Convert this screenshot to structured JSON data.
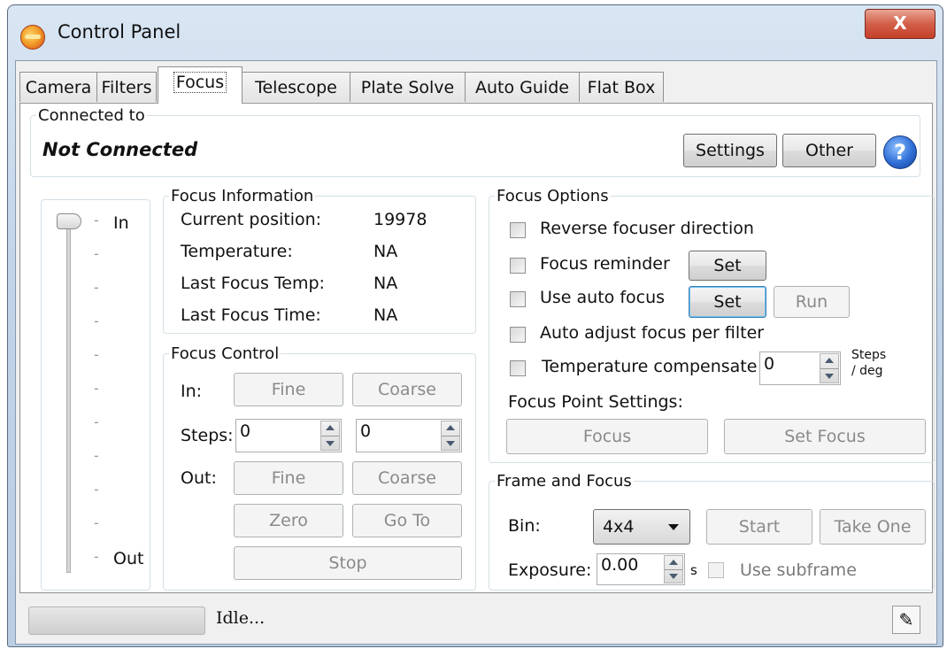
{
  "window": {
    "title": "Control Panel",
    "close_glyph": "X"
  },
  "tabs": [
    {
      "label": "Camera"
    },
    {
      "label": "Filters"
    },
    {
      "label": "Focus"
    },
    {
      "label": "Telescope"
    },
    {
      "label": "Plate Solve"
    },
    {
      "label": "Auto Guide"
    },
    {
      "label": "Flat Box"
    }
  ],
  "connection": {
    "legend": "Connected to",
    "status": "Not Connected",
    "settings_label": "Settings",
    "other_label": "Other",
    "help_glyph": "?"
  },
  "slider": {
    "in_label": "In",
    "out_label": "Out",
    "position_fraction": 0
  },
  "focus_info": {
    "legend": "Focus Information",
    "rows": [
      {
        "label": "Current position:",
        "value": "19978"
      },
      {
        "label": "Temperature:",
        "value": "NA"
      },
      {
        "label": "Last Focus Temp:",
        "value": "NA"
      },
      {
        "label": "Last Focus Time:",
        "value": "NA"
      }
    ]
  },
  "focus_control": {
    "legend": "Focus Control",
    "in_label": "In:",
    "steps_label": "Steps:",
    "out_label": "Out:",
    "fine": "Fine",
    "coarse": "Coarse",
    "fine_steps": "0",
    "coarse_steps": "0",
    "zero": "Zero",
    "goto": "Go To",
    "stop": "Stop"
  },
  "focus_options": {
    "legend": "Focus Options",
    "reverse": "Reverse focuser direction",
    "reminder": "Focus reminder",
    "auto_focus": "Use auto focus",
    "set": "Set",
    "run": "Run",
    "auto_adjust": "Auto adjust focus per filter",
    "temp_comp": "Temperature compensate",
    "temp_value": "0",
    "steps_unit_1": "Steps",
    "steps_unit_2": "/ deg",
    "point_settings": "Focus Point Settings:",
    "focus_btn": "Focus",
    "set_focus_btn": "Set Focus"
  },
  "frame_focus": {
    "legend": "Frame and Focus",
    "bin_label": "Bin:",
    "bin_value": "4x4",
    "start": "Start",
    "take_one": "Take One",
    "exposure_label": "Exposure:",
    "exposure_value": "0.00",
    "exposure_unit": "s",
    "subframe": "Use subframe"
  },
  "status": {
    "text": "Idle...",
    "progress": 0
  }
}
